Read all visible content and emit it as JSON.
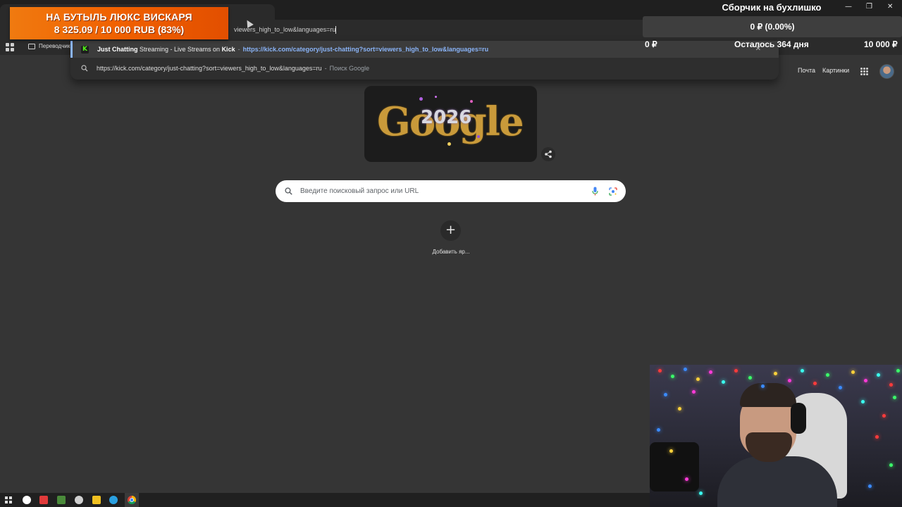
{
  "browser": {
    "omnibox_text": "viewers_high_to_low&languages=ru",
    "bookmarks": [
      {
        "label": "Переводчик"
      }
    ],
    "suggestions": [
      {
        "title_strong": "Just Chatting",
        "title_rest": " Streaming - Live Streams on ",
        "title_site": "Kick",
        "separator": "-",
        "url": "https://kick.com/category/just-chatting?sort=viewers_high_to_low&languages=ru",
        "icon": "kick-icon"
      },
      {
        "text": "https://kick.com/category/just-chatting?sort=viewers_high_to_low&languages=ru",
        "separator": "-",
        "source": "Поиск Google",
        "icon": "search-icon"
      }
    ]
  },
  "google": {
    "header_links": [
      "Почта",
      "Картинки"
    ],
    "doodle_text": "Google",
    "doodle_year": "2026",
    "search_placeholder": "Введите поисковый запрос или URL",
    "shortcut_add_label": "Добавить яр..."
  },
  "overlay": {
    "donation_title": "НА БУТЫЛЬ ЛЮКС ВИСКАРЯ",
    "donation_progress_text": "8 325.09 / 10 000 RUB (83%)",
    "goal_title": "Сборчик на бухлишко",
    "goal_percent_text": "0 ₽ (0.00%)",
    "goal_fraction": 0.0,
    "goal_min": "0 ₽",
    "goal_days_left": "Осталось 364 дня",
    "goal_max": "10 000 ₽"
  },
  "window_controls": [
    "—",
    "❐",
    "✕"
  ],
  "taskbar": {
    "apps": [
      "start-icon",
      "yandex-browser-icon",
      "yandex-icon",
      "app-icon",
      "clock-icon",
      "app-icon-2",
      "telegram-icon",
      "chrome-icon"
    ]
  },
  "colors": {
    "accent_link": "#8ab4f8",
    "kick_green": "#53fc18",
    "donation_orange": "#f06000",
    "background": "#353535"
  }
}
